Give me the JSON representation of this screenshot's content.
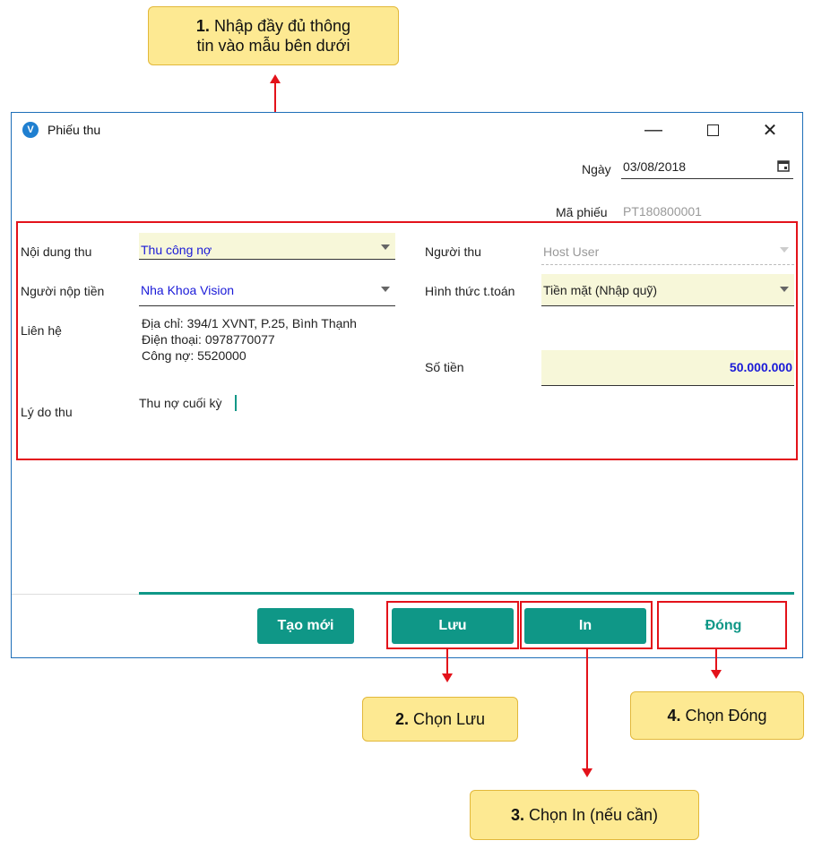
{
  "callouts": {
    "step1_num": "1.",
    "step1_line1": " Nhập đầy đủ thông",
    "step1_line2": "tin vào mẫu bên dưới",
    "step2_num": "2.",
    "step2_text": " Chọn Lưu",
    "step3_num": "3.",
    "step3_text": " Chọn In (nếu cần)",
    "step4_num": "4.",
    "step4_text": " Chọn Đóng"
  },
  "window": {
    "title": "Phiếu thu",
    "icon": "app-logo-icon",
    "controls": {
      "minimize": "—",
      "close": "✕"
    }
  },
  "header": {
    "date_label": "Ngày",
    "date_value": "03/08/2018",
    "voucher_label": "Mã phiếu",
    "voucher_value": "PT180800001"
  },
  "form": {
    "content_label": "Nội dung thu",
    "content_value": "Thu công nợ",
    "payer_label": "Người nộp tiền",
    "payer_value": "Nha Khoa Vision",
    "contact_label": "Liên hệ",
    "contact_address": "Địa chỉ: 394/1 XVNT, P.25, Bình Thạnh",
    "contact_phone": "Điện thoại: 0978770077",
    "contact_debt": "Công nợ: 5520000",
    "reason_label": "Lý do thu",
    "reason_value": "Thu nợ cuối kỳ",
    "receiver_label": "Người thu",
    "receiver_value": "Host User",
    "method_label": "Hình thức t.toán",
    "method_value": "Tiền mặt (Nhập quỹ)",
    "amount_label": "Số tiền",
    "amount_value": "50.000.000"
  },
  "buttons": {
    "new": "Tạo mới",
    "save": "Lưu",
    "print": "In",
    "close": "Đóng"
  },
  "colors": {
    "accent": "#0f9787",
    "highlight_field": "#f7f7d9",
    "link_blue": "#1a1ad8",
    "annotation_red": "#e3121a",
    "callout_yellow": "#fde992"
  }
}
